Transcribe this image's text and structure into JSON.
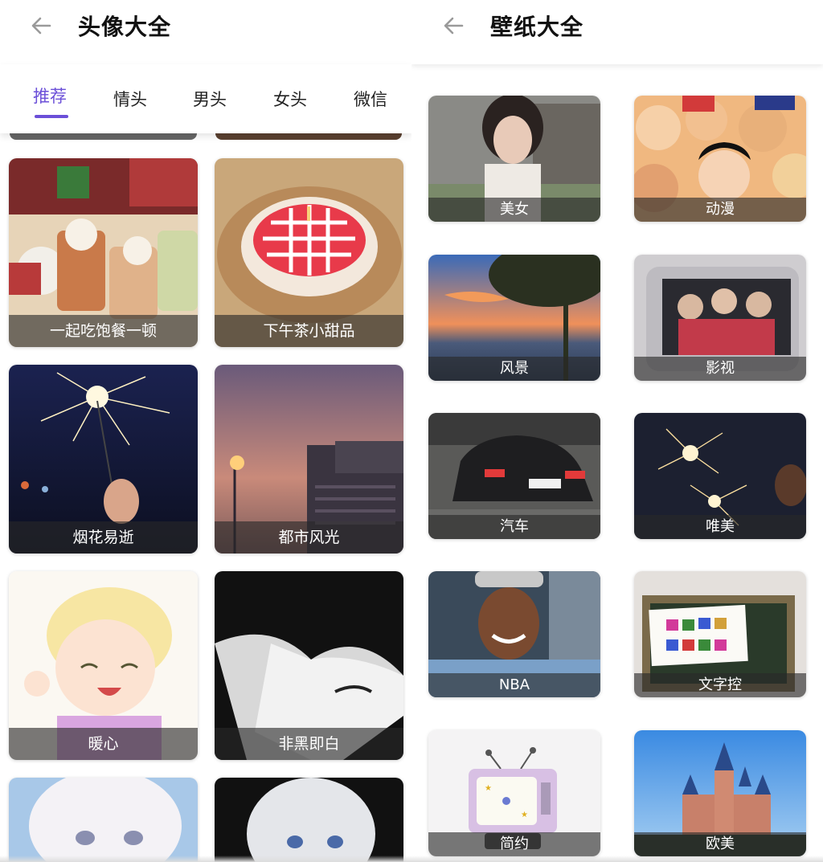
{
  "left": {
    "title": "头像大全",
    "tabs": [
      "推荐",
      "情头",
      "男头",
      "女头",
      "微信"
    ],
    "active_tab": "推荐",
    "cards": [
      {
        "label": "一起吃饱餐一顿"
      },
      {
        "label": "下午茶小甜品"
      },
      {
        "label": "烟花易逝"
      },
      {
        "label": "都市风光"
      },
      {
        "label": "暖心"
      },
      {
        "label": "非黑即白"
      },
      {
        "label": ""
      },
      {
        "label": ""
      }
    ]
  },
  "right": {
    "title": "壁纸大全",
    "cards": [
      {
        "label": "美女"
      },
      {
        "label": "动漫"
      },
      {
        "label": "风景"
      },
      {
        "label": "影视"
      },
      {
        "label": "汽车"
      },
      {
        "label": "唯美"
      },
      {
        "label": "NBA"
      },
      {
        "label": "文字控"
      },
      {
        "label": "简约"
      },
      {
        "label": "欧美"
      }
    ]
  },
  "colors": {
    "accent": "#6b4fd8",
    "caption_bg": "#282828"
  },
  "icons": {
    "back": "arrow-left-icon"
  }
}
